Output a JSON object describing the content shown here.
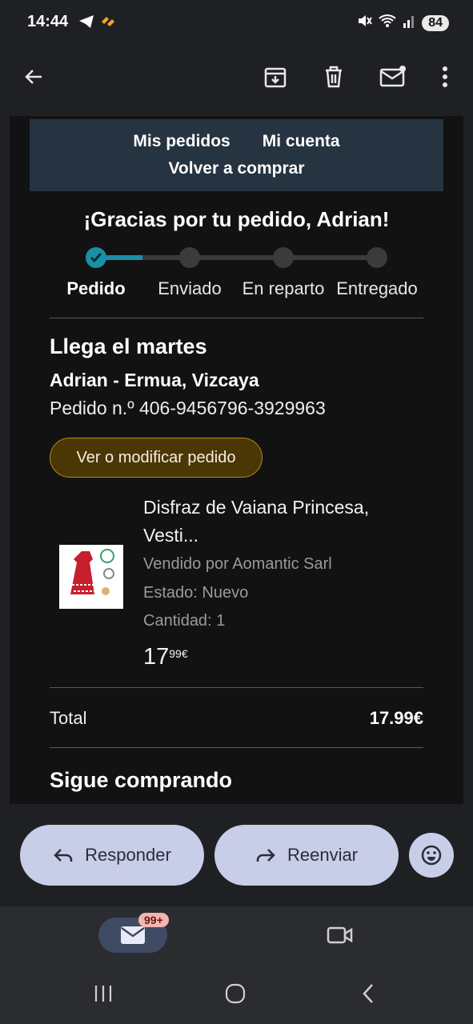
{
  "status_bar": {
    "time": "14:44",
    "battery": "84"
  },
  "app_bar": {
    "back_icon": "arrow-left-icon",
    "actions": [
      "archive-icon",
      "delete-icon",
      "mark-unread-icon",
      "more-vert-icon"
    ]
  },
  "email": {
    "nav": {
      "my_orders": "Mis pedidos",
      "my_account": "Mi cuenta",
      "buy_again": "Volver a comprar"
    },
    "thanks": "¡Gracias por tu pedido, Adrian!",
    "steps": [
      {
        "label": "Pedido",
        "done": true
      },
      {
        "label": "Enviado",
        "done": false
      },
      {
        "label": "En reparto",
        "done": false
      },
      {
        "label": "Entregado",
        "done": false
      }
    ],
    "progress": 0.17,
    "arrival": "Llega el martes",
    "recipient": "Adrian - Ermua, Vizcaya",
    "order_number": "Pedido n.º 406-9456796-3929963",
    "modify_button": "Ver o modificar pedido",
    "product": {
      "title": "Disfraz de Vaiana Princesa, Vesti...",
      "seller": "Vendido por Aomantic Sarl",
      "condition": "Estado: Nuevo",
      "quantity": "Cantidad: 1",
      "price_whole": "17",
      "price_fraction": "99€"
    },
    "total_label": "Total",
    "total_value": "17.99€",
    "keep_shopping": "Sigue comprando"
  },
  "actions": {
    "reply": "Responder",
    "forward": "Reenviar"
  },
  "bottom_nav": {
    "mail_badge": "99+"
  },
  "colors": {
    "accent": "#1b8fa6",
    "button": "#c8cde8",
    "nav_bg": "#263340",
    "pill_bg": "#4a3705"
  }
}
